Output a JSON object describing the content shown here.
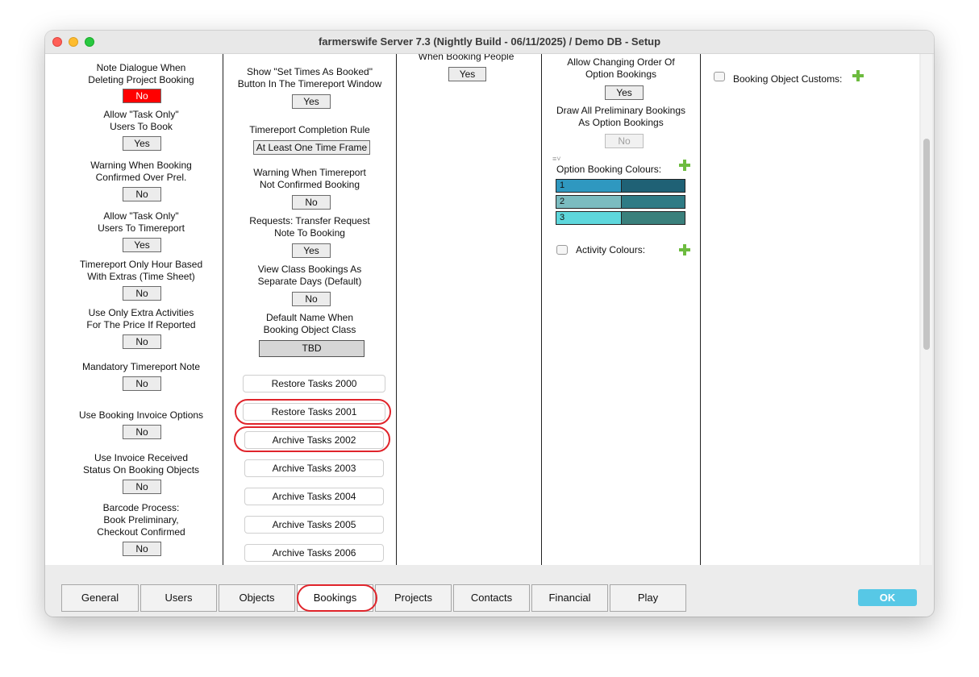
{
  "window": {
    "title": "farmerswife Server 7.3 (Nightly Build - 06/11/2025) / Demo DB - Setup"
  },
  "col1": {
    "items": [
      {
        "label": "Note Dialogue When\nDeleting Project Booking",
        "value": "No"
      },
      {
        "label": "Allow \"Task Only\"\nUsers To Book",
        "value": "Yes"
      },
      {
        "label": "Warning When Booking\nConfirmed Over Prel.",
        "value": "No"
      },
      {
        "label": "Allow \"Task Only\"\nUsers To Timereport",
        "value": "Yes"
      },
      {
        "label": "Timereport Only Hour Based\nWith Extras (Time Sheet)",
        "value": "No"
      },
      {
        "label": "Use Only Extra Activities\nFor The Price If Reported",
        "value": "No"
      },
      {
        "label": "Mandatory Timereport Note",
        "value": "No"
      },
      {
        "label": "Use Booking Invoice Options",
        "value": "No"
      },
      {
        "label": "Use Invoice Received\nStatus On Booking Objects",
        "value": "No"
      },
      {
        "label": "Barcode Process:\nBook Preliminary,\nCheckout Confirmed",
        "value": "No"
      }
    ]
  },
  "col2": {
    "items": [
      {
        "label": "Show \"Set Times As Booked\"\nButton In The Timereport Window",
        "value": "Yes"
      },
      {
        "label": "Timereport Completion Rule",
        "value": "At Least One Time Frame"
      },
      {
        "label": "Warning When Timereport\nNot Confirmed Booking",
        "value": "No"
      },
      {
        "label": "Requests: Transfer Request\nNote To Booking",
        "value": "Yes"
      },
      {
        "label": "View Class Bookings As\nSeparate Days (Default)",
        "value": "No"
      },
      {
        "label": "Default Name When\nBooking Object Class",
        "value": "TBD"
      }
    ],
    "task_buttons": [
      "Restore Tasks 2000",
      "Restore Tasks 2001",
      "Archive Tasks 2002",
      "Archive Tasks 2003",
      "Archive Tasks 2004",
      "Archive Tasks 2005",
      "Archive Tasks 2006"
    ]
  },
  "col3": {
    "label": "When Booking People",
    "value": "Yes"
  },
  "col4": {
    "items": [
      {
        "label": "Allow Changing Order Of\nOption Bookings",
        "value": "Yes"
      },
      {
        "label": "Draw All Preliminary Bookings\nAs Option Bookings",
        "value": "No"
      }
    ],
    "option_colours_label": "Option Booking Colours:",
    "option_colours": [
      {
        "label": "1",
        "left": "#2f98c0",
        "right": "#1f6175"
      },
      {
        "label": "2",
        "left": "#7bbcc0",
        "right": "#2f7b85"
      },
      {
        "label": "3",
        "left": "#5ed7dc",
        "right": "#3a807c"
      }
    ],
    "activity_colours_label": "Activity Colours:"
  },
  "col5": {
    "label": "Booking Object Customs:"
  },
  "tabs": [
    "General",
    "Users",
    "Objects",
    "Bookings",
    "Projects",
    "Contacts",
    "Financial",
    "Play"
  ],
  "active_tab": "Bookings",
  "ok_label": "OK",
  "colors": {
    "no_highlight": "#ff0000",
    "annotation": "#e0242b",
    "ok": "#57c8e6",
    "plus": "#6dbb3f"
  }
}
